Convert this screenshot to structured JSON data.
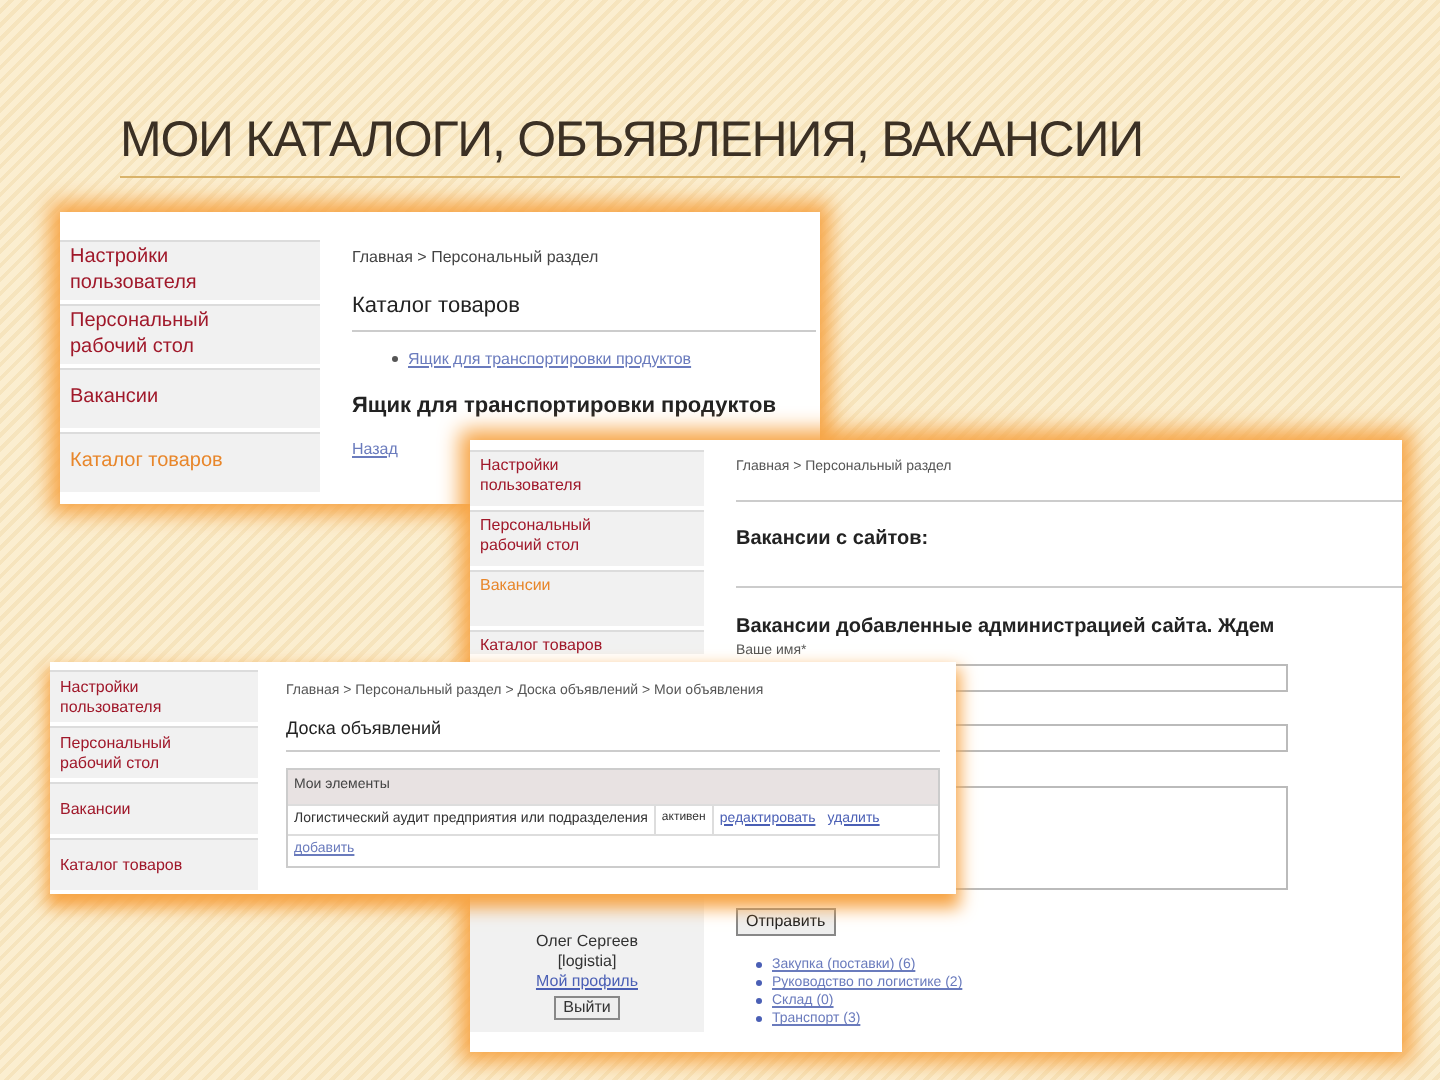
{
  "slide": {
    "title": "МОИ КАТАЛОГИ, ОБЪЯВЛЕНИЯ, ВАКАНСИИ"
  },
  "catalog_screen": {
    "sidebar": [
      {
        "label": "Настройки пользователя",
        "selected": false
      },
      {
        "label": "Персональный рабочий стол",
        "selected": false
      },
      {
        "label": "Вакансии",
        "selected": false
      },
      {
        "label": "Каталог товаров",
        "selected": true
      }
    ],
    "breadcrumb": "Главная > Персональный раздел",
    "heading": "Каталог товаров",
    "items": [
      "Ящик для транспортировки продуктов"
    ],
    "item_heading": "Ящик для транспортировки продуктов",
    "back_link": "Назад"
  },
  "vacancies_screen": {
    "sidebar": [
      {
        "label": "Настройки пользователя",
        "selected": false
      },
      {
        "label": "Персональный рабочий стол",
        "selected": false
      },
      {
        "label": "Вакансии",
        "selected": true
      },
      {
        "label": "Каталог товаров",
        "selected": false
      }
    ],
    "breadcrumb": "Главная > Персональный раздел",
    "heading": "Вакансии с сайтов:",
    "heading_2": "Вакансии добавленные администрацией сайта. Ждем",
    "name_label": "Ваше имя*",
    "submit": "Отправить",
    "user": {
      "name": "Олег Сергеев",
      "login": "[logistia]",
      "profile_link": "Мой профиль",
      "logout": "Выйти"
    },
    "categories": [
      "Закупка (поставки) (6)",
      "Руководство по логистике (2)",
      "Склад (0)",
      "Транспорт (3)"
    ]
  },
  "ads_screen": {
    "sidebar": [
      {
        "label": "Настройки пользователя",
        "selected": false
      },
      {
        "label": "Персональный рабочий стол",
        "selected": false
      },
      {
        "label": "Вакансии",
        "selected": false
      },
      {
        "label": "Каталог товаров",
        "selected": false
      }
    ],
    "breadcrumb": "Главная > Персональный раздел > Доска объявлений > Мои объявления",
    "heading": "Доска объявлений",
    "table": {
      "header": "Мои элементы",
      "rows": [
        {
          "title": "Логистический аудит предприятия или подразделения",
          "status": "активен",
          "edit": "редактировать",
          "delete": "удалить"
        }
      ],
      "add_link": "добавить"
    }
  }
}
